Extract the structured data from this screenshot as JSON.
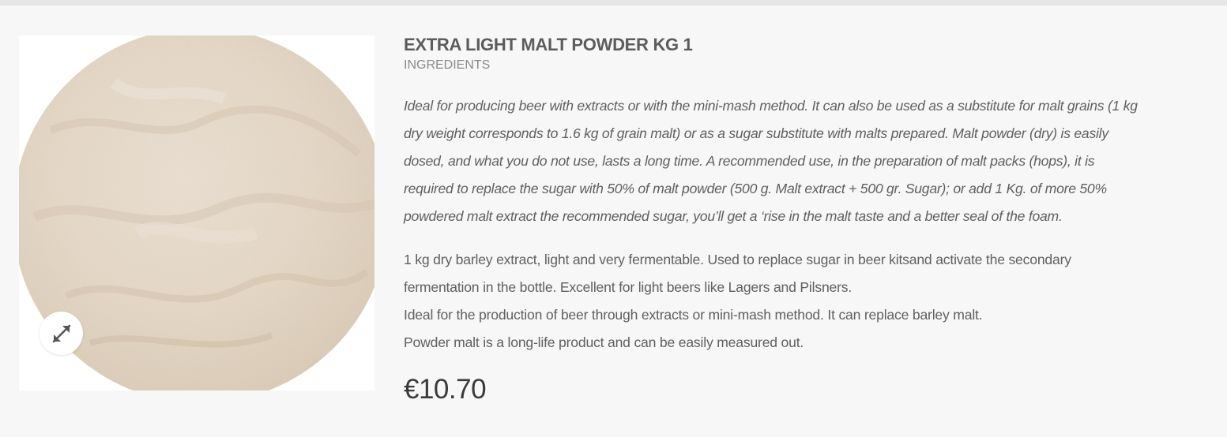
{
  "product": {
    "title": "EXTRA LIGHT MALT POWDER KG 1",
    "category": "INGREDIENTS",
    "description_italic": "Ideal for producing beer with extracts or with the mini-mash method. It can also be used as a substitute for malt grains (1 kg dry weight corresponds to 1.6 kg of grain malt) or as a sugar substitute with malts prepared. Malt powder (dry) is easily dosed, and what you do not use, lasts a long time. A recommended use, in the preparation of malt packs (hops), it is required to replace the sugar with 50% of malt powder (500 g. Malt extract + 500 gr. Sugar); or add 1 Kg. of more 50% powdered malt extract the recommended sugar, you’ll get a ‘rise in the malt taste and a better seal of the foam.",
    "description_lines": [
      "1 kg dry barley extract, light and very fermentable. Used to replace sugar in beer kitsand activate the secondary fermentation in the bottle. Excellent for light beers like Lagers and Pilsners.",
      "Ideal for the production of beer through extracts or mini-mash method. It can replace barley malt.",
      "Powder malt is a long-life product and can be easily measured out."
    ],
    "price": "€10.70",
    "image_icon": "malt-powder-bowl-image",
    "zoom_icon": "expand-arrows-icon"
  },
  "colors": {
    "background": "#f7f7f7",
    "top_strip": "#e6e6e6",
    "title": "#5c5c5c",
    "text": "#5f5f5f",
    "price": "#3a3a3a",
    "powder": "#ece1d3"
  }
}
